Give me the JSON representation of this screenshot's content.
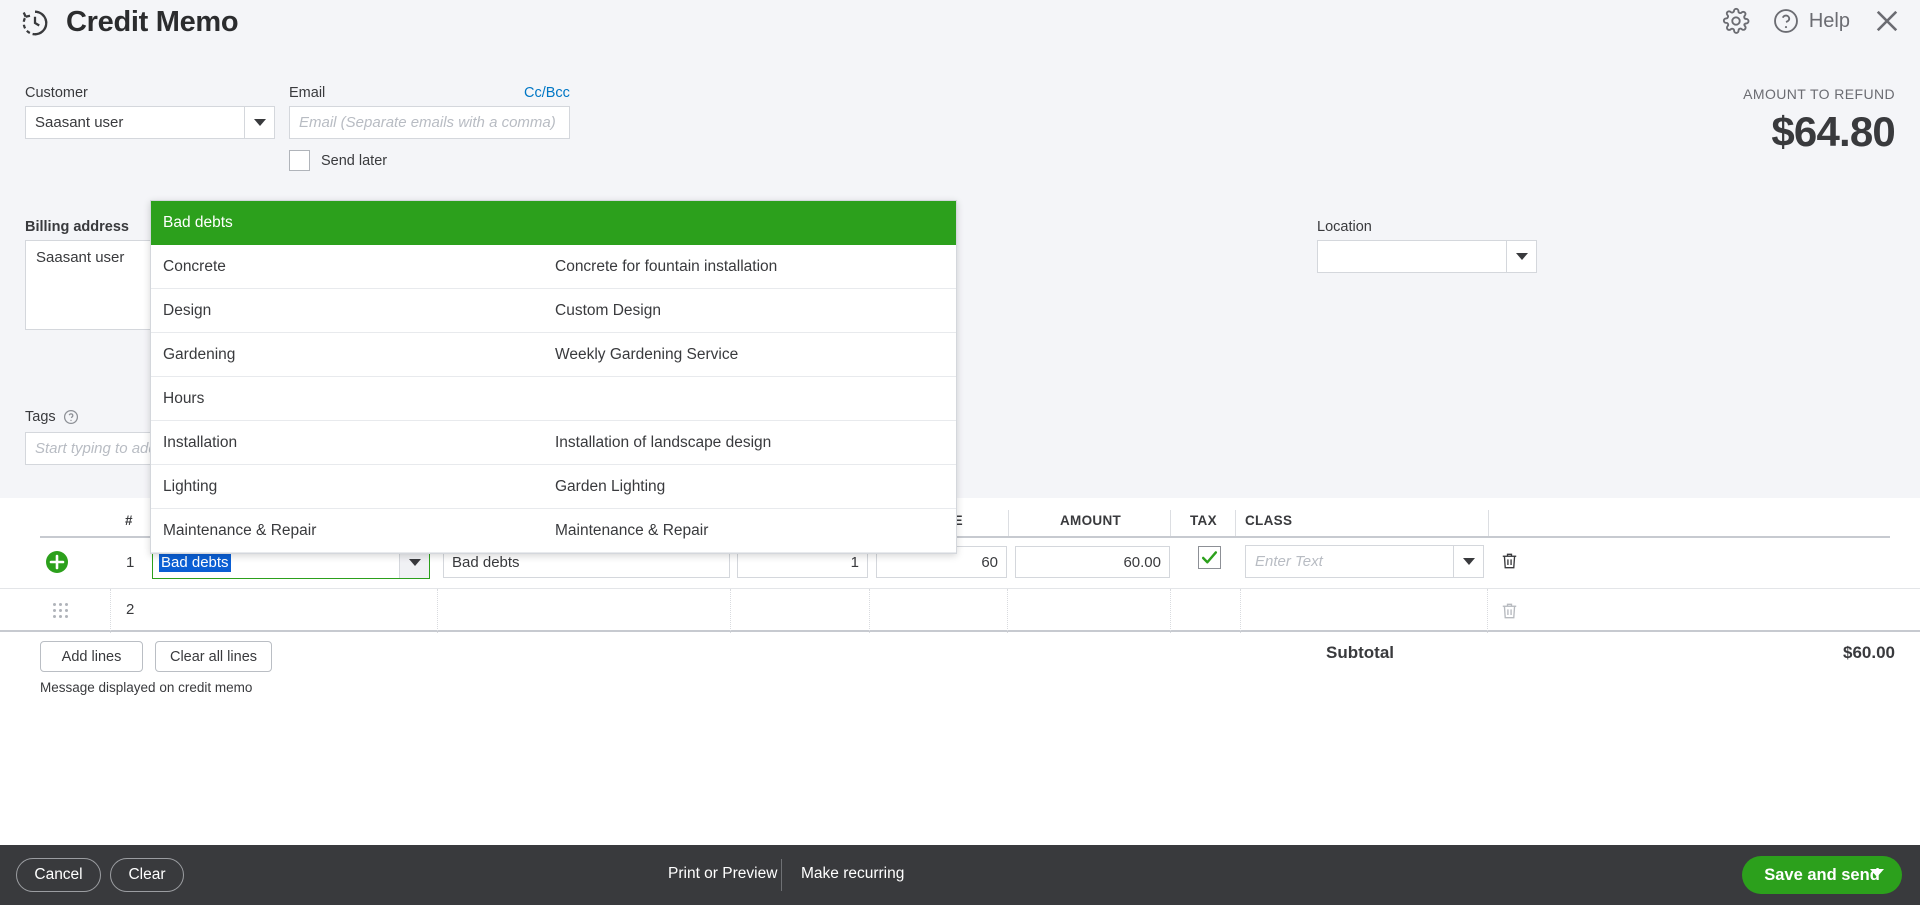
{
  "header": {
    "title": "Credit Memo",
    "doc_icon": "credit-memo-icon",
    "gear_icon": "gear-icon",
    "help_icon": "question-circle-icon",
    "help_label": "Help",
    "close_icon": "close-icon"
  },
  "form": {
    "customer_label": "Customer",
    "customer_value": "Saasant user",
    "email_label": "Email",
    "email_value": "",
    "email_placeholder": "Email (Separate emails with a comma)",
    "ccbcc_label": "Cc/Bcc",
    "send_later_label": "Send later",
    "send_later_checked": false,
    "billing_address_label": "Billing address",
    "billing_address_value": "Saasant user",
    "tags_label": "Tags",
    "tags_value": "",
    "tags_placeholder": "Start typing to add a tag",
    "location_label": "Location",
    "location_value": "",
    "amount_label": "AMOUNT TO REFUND",
    "amount_value": "$64.80"
  },
  "dropdown": {
    "open": true,
    "options": [
      {
        "name": "Bad debts",
        "description": "",
        "selected": true
      },
      {
        "name": "Concrete",
        "description": "Concrete for fountain installation",
        "selected": false
      },
      {
        "name": "Design",
        "description": "Custom Design",
        "selected": false
      },
      {
        "name": "Gardening",
        "description": "Weekly Gardening Service",
        "selected": false
      },
      {
        "name": "Hours",
        "description": "",
        "selected": false
      },
      {
        "name": "Installation",
        "description": "Installation of landscape design",
        "selected": false
      },
      {
        "name": "Lighting",
        "description": "Garden Lighting",
        "selected": false
      },
      {
        "name": "Maintenance & Repair",
        "description": "Maintenance & Repair",
        "selected": false
      }
    ]
  },
  "table": {
    "headers": {
      "num": "#",
      "rate": "RATE",
      "amount": "AMOUNT",
      "tax": "TAX",
      "class": "CLASS"
    },
    "rows": [
      {
        "num": "1",
        "product": "Bad debts",
        "description": "Bad debts",
        "qty": "1",
        "rate": "60",
        "amount": "60.00",
        "tax_checked": true,
        "class_value": "",
        "class_placeholder": "Enter Text",
        "add_icon": "add-circle-icon",
        "delete_icon": "trash-icon"
      },
      {
        "num": "2",
        "product": "",
        "description": "",
        "qty": "",
        "rate": "",
        "amount": "",
        "tax_checked": false,
        "class_value": "",
        "class_placeholder": "",
        "drag_icon": "drag-handle-icon",
        "delete_icon": "trash-icon"
      }
    ],
    "add_lines_label": "Add lines",
    "clear_all_lines_label": "Clear all lines",
    "message_note": "Message displayed on credit memo",
    "subtotal_label": "Subtotal",
    "subtotal_value": "$60.00"
  },
  "footer": {
    "cancel_label": "Cancel",
    "clear_label": "Clear",
    "print_label": "Print or Preview",
    "recurring_label": "Make recurring",
    "save_label": "Save and send",
    "save_caret_icon": "chevron-down-icon"
  },
  "colors": {
    "brand_green": "#2ca01c",
    "link_blue": "#0077c5",
    "footer_dark": "#393a3d",
    "selection_blue": "#0b5fd4",
    "page_bg": "#f4f5f8"
  }
}
